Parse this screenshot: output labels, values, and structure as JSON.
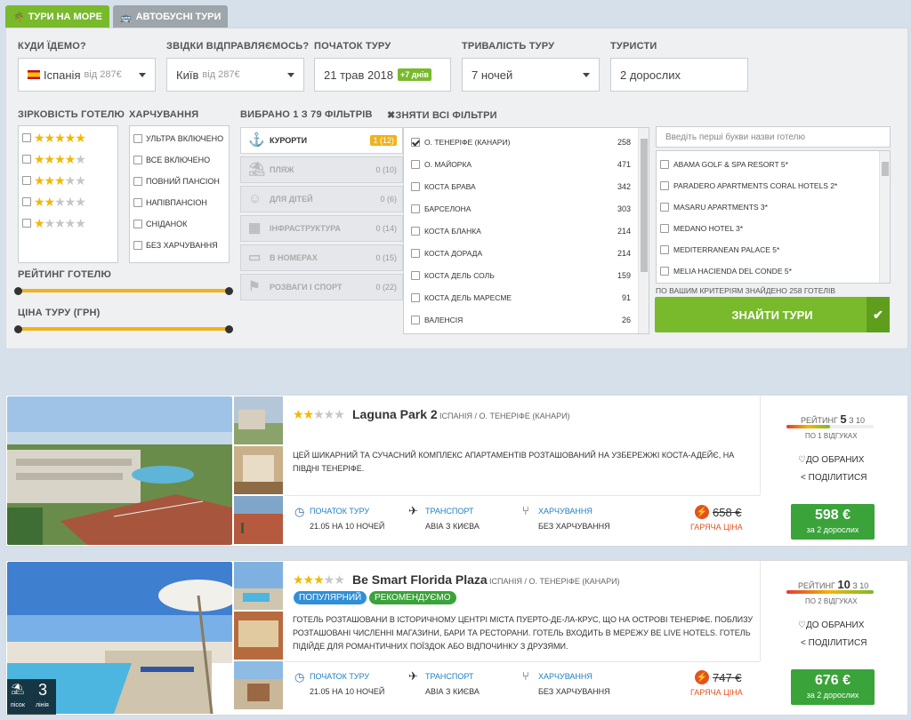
{
  "tabs": [
    {
      "label": "ТУРИ НА МОРЕ",
      "icon": "palm-icon",
      "active": true
    },
    {
      "label": "АВТОБУСНІ ТУРИ",
      "icon": "bus-icon",
      "active": false
    }
  ],
  "search": {
    "destination": {
      "label": "КУДИ ЇДЕМО?",
      "value": "Іспанія",
      "price_hint": "від 287€",
      "flag": "spain-flag-icon"
    },
    "departure": {
      "label": "ЗВІДКИ ВІДПРАВЛЯЄМОСЬ?",
      "value": "Київ",
      "price_hint": "від 287€"
    },
    "start": {
      "label": "ПОЧАТОК ТУРУ",
      "value": "21 трав 2018",
      "badge": "+7 днів"
    },
    "duration": {
      "label": "ТРИВАЛІСТЬ ТУРУ",
      "value": "7 ночей"
    },
    "tourists": {
      "label": "ТУРИСТИ",
      "value": "2 дорослих"
    }
  },
  "hotel_stars": {
    "label": "ЗІРКОВІСТЬ ГОТЕЛЮ",
    "levels": [
      5,
      4,
      3,
      2,
      1
    ]
  },
  "meals": {
    "label": "ХАРЧУВАННЯ",
    "options": [
      "УЛЬТРА ВКЛЮЧЕНО",
      "ВСЕ ВКЛЮЧЕНО",
      "ПОВНИЙ ПАНСІОН",
      "НАПІВПАНСІОН",
      "СНІДАНОК",
      "БЕЗ ХАРЧУВАННЯ"
    ]
  },
  "filters": {
    "selected_label": "ВИБРАНО 1 З 79 ФІЛЬТРІВ",
    "clear_label": "ЗНЯТИ ВСІ ФІЛЬТРИ",
    "categories": [
      {
        "label": "КУРОРТИ",
        "count": "1 (12)",
        "icon": "anchor-icon",
        "active": true
      },
      {
        "label": "ПЛЯЖ",
        "count": "0 (10)",
        "icon": "beach-icon",
        "active": false
      },
      {
        "label": "ДЛЯ ДІТЕЙ",
        "count": "0 (6)",
        "icon": "child-icon",
        "active": false
      },
      {
        "label": "ІНФРАСТРУКТУРА",
        "count": "0 (14)",
        "icon": "building-icon",
        "active": false
      },
      {
        "label": "В НОМЕРАХ",
        "count": "0 (15)",
        "icon": "bed-icon",
        "active": false
      },
      {
        "label": "РОЗВАГИ І СПОРТ",
        "count": "0 (22)",
        "icon": "sport-icon",
        "active": false
      }
    ]
  },
  "resorts": [
    {
      "name": "О. ТЕНЕРІФЕ (КАНАРИ)",
      "count": "258",
      "checked": true
    },
    {
      "name": "О. МАЙОРКА",
      "count": "471",
      "checked": false
    },
    {
      "name": "КОСТА БРАВА",
      "count": "342",
      "checked": false
    },
    {
      "name": "БАРСЕЛОНА",
      "count": "303",
      "checked": false
    },
    {
      "name": "КОСТА БЛАНКА",
      "count": "214",
      "checked": false
    },
    {
      "name": "КОСТА ДОРАДА",
      "count": "214",
      "checked": false
    },
    {
      "name": "КОСТА ДЕЛЬ СОЛЬ",
      "count": "159",
      "checked": false
    },
    {
      "name": "КОСТА ДЕЛЬ МАРЕСМЕ",
      "count": "91",
      "checked": false
    },
    {
      "name": "ВАЛЕНСІЯ",
      "count": "26",
      "checked": false
    }
  ],
  "hotel_search": {
    "placeholder": "Введіть перші букви назви готелю",
    "hotels": [
      "ABAMA GOLF & SPA RESORT 5*",
      "PARADERO APARTMENTS CORAL HOTELS 2*",
      "MASARU APARTMENTS 3*",
      "MEDANO HOTEL 3*",
      "MEDITERRANEAN PALACE 5*",
      "MELIA HACIENDA DEL CONDE 5*"
    ],
    "found_text": "ПО ВАШИМ КРИТЕРІЯМ ЗНАЙДЕНО 258 ГОТЕЛІВ",
    "button": "ЗНАЙТИ ТУРИ"
  },
  "sliders": {
    "rating_label": "РЕЙТИНГ ГОТЕЛЮ",
    "price_label": "ЦІНА ТУРУ (ГРН)"
  },
  "results": [
    {
      "name": "Laguna Park 2",
      "stars": 2,
      "location": "ІСПАНІЯ / О. ТЕНЕРІФЕ (КАНАРИ)",
      "description": "ЦЕЙ ШИКАРНИЙ ТА СУЧАСНИЙ КОМПЛЕКС АПАРТАМЕНТІВ РОЗТАШОВАНИЙ НА УЗБЕРЕЖЖІ КОСТА-АДЕЙЄ, НА ПІВДНІ ТЕНЕРІФЕ.",
      "rating_label": "РЕЙТИНГ",
      "rating": "5",
      "rating_of": "З 10",
      "reviews": "ПО 1 ВІДГУКАХ",
      "rating_fill": 0.5,
      "favorite": "ДО ОБРАНИХ",
      "share": "ПОДІЛИТИСЯ",
      "start_label": "ПОЧАТОК ТУРУ",
      "start_value": "21.05 НА 10 НОЧЕЙ",
      "transport_label": "ТРАНСПОРТ",
      "transport_value": "АВІА З КИЄВА",
      "meal_label": "ХАРЧУВАННЯ",
      "meal_value": "БЕЗ ХАРЧУВАННЯ",
      "old_price": "658 €",
      "hot_label": "ГАРЯЧА ЦІНА",
      "price": "598 €",
      "price_sub": "за 2 дорослих",
      "badges": []
    },
    {
      "name": "Be Smart Florida Plaza",
      "stars": 3,
      "location": "ІСПАНІЯ / О. ТЕНЕРІФЕ (КАНАРИ)",
      "description": "ГОТЕЛЬ РОЗТАШОВАНИ В ІСТОРИЧНОМУ ЦЕНТРІ МІСТА ПУЕРТО-ДЕ-ЛА-КРУС, ЩО НА ОСТРОВІ ТЕНЕРІФЕ. ПОБЛИЗУ РОЗТАШОВАНІ ЧИСЛЕННІ МАГАЗИНИ, БАРИ ТА РЕСТОРАНИ. ГОТЕЛЬ ВХОДИТЬ В МЕРЕЖУ BE LIVE HOTELS. ГОТЕЛЬ ПІДІЙДЕ ДЛЯ РОМАНТИЧНИХ ПОЇЗДОК АБО ВІДПОЧИНКУ З ДРУЗЯМИ.",
      "rating_label": "РЕЙТИНГ",
      "rating": "10",
      "rating_of": "З 10",
      "reviews": "ПО 2 ВІДГУКАХ",
      "rating_fill": 1.0,
      "favorite": "ДО ОБРАНИХ",
      "share": "ПОДІЛИТИСЯ",
      "start_label": "ПОЧАТОК ТУРУ",
      "start_value": "21.05 НА 10 НОЧЕЙ",
      "transport_label": "ТРАНСПОРТ",
      "transport_value": "АВІА З КИЄВА",
      "meal_label": "ХАРЧУВАННЯ",
      "meal_value": "БЕЗ ХАРЧУВАННЯ",
      "old_price": "747 €",
      "hot_label": "ГАРЯЧА ЦІНА",
      "price": "676 €",
      "price_sub": "за 2 дорослих",
      "badges": [
        {
          "label": "ПОПУЛЯРНИЙ",
          "color": "#2f8fd8"
        },
        {
          "label": "РЕКОМЕНДУЄМО",
          "color": "#3aa33a"
        }
      ],
      "beach": {
        "value": "3",
        "sand": "пісок",
        "line": "лінія"
      }
    }
  ],
  "colors": {
    "accent": "#78ba2b",
    "slider": "#f0b21a",
    "hot": "#e3521e",
    "price": "#3aa33a",
    "link": "#1e7fc6"
  }
}
